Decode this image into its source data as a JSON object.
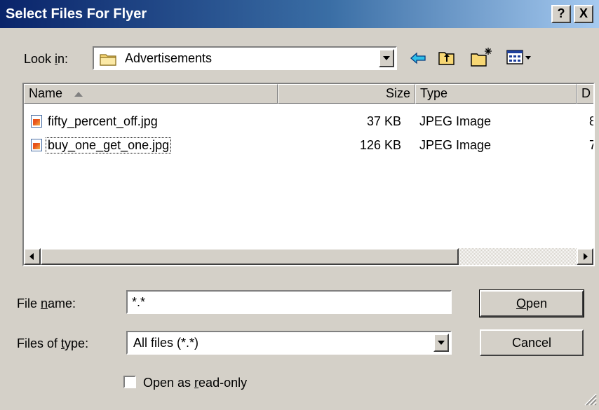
{
  "window": {
    "title": "Select Files For Flyer",
    "help_label": "?",
    "close_label": "X"
  },
  "lookin": {
    "label_pre": "Look ",
    "label_accel": "i",
    "label_post": "n:",
    "value": "Advertisements"
  },
  "toolbar": {
    "icons": [
      "back-icon",
      "up-folder-icon",
      "new-folder-icon",
      "view-menu-icon"
    ]
  },
  "filelist": {
    "columns": {
      "name": "Name",
      "size": "Size",
      "type": "Type",
      "date_partial": "D"
    },
    "rows": [
      {
        "name": "fifty_percent_off.jpg",
        "size": "37 KB",
        "type": "JPEG Image",
        "date_partial": "8",
        "selected": false
      },
      {
        "name": "buy_one_get_one.jpg",
        "size": "126 KB",
        "type": "JPEG Image",
        "date_partial": "7",
        "selected": false,
        "focused": true
      }
    ]
  },
  "filename": {
    "label_pre": "File ",
    "label_accel": "n",
    "label_post": "ame:",
    "value": "*.*"
  },
  "filetype": {
    "label_pre": "Files of ",
    "label_accel": "t",
    "label_post": "ype:",
    "value": "All files (*.*)"
  },
  "buttons": {
    "open_accel": "O",
    "open_rest": "pen",
    "cancel": "Cancel"
  },
  "readonly": {
    "label_pre": "Open as ",
    "label_accel": "r",
    "label_post": "ead-only",
    "checked": false
  },
  "colors": {
    "face": "#d4d0c8",
    "title_start": "#0a246a",
    "title_end": "#a6caf0"
  }
}
